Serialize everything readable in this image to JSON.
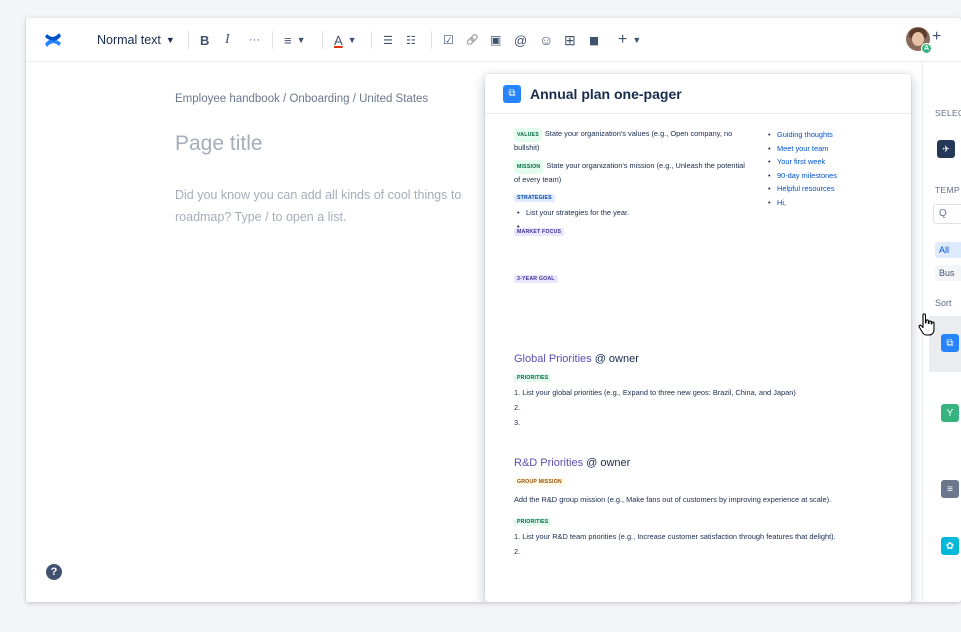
{
  "toolbar": {
    "text_style": "Normal text",
    "bold": "B",
    "italic": "I",
    "more": "···",
    "align": "≡",
    "text_color": "A",
    "bullet_list": "☰",
    "numbered_list": "☷",
    "action_item": "☑",
    "link": "🔗",
    "image": "▣",
    "mention": "@",
    "emoji": "☺",
    "table": "⊞",
    "layouts": "▮▮",
    "insert": "+",
    "avatar_badge": "A",
    "invite": "+"
  },
  "editor": {
    "breadcrumb": "Employee handbook  /  Onboarding / United States",
    "page_title": "Page title",
    "placeholder": "Did you know you can add all kinds of cool things to roadmap? Type / to open a list."
  },
  "help_icon": "?",
  "preview": {
    "title": "Annual plan one-pager",
    "values_label": "VALUES",
    "values_text": "State your organization's values (e.g., Open company, no bullshit)",
    "mission_label": "MISSION",
    "mission_text": "State your organization's mission (e.g., Unleash the potential of every team)",
    "strategies_label": "STRATEGIES",
    "strategies": [
      "List your strategies for the year.",
      "",
      ""
    ],
    "market_focus_label": "MARKET FOCUS",
    "goal_label": "3-YEAR GOAL",
    "right_links": [
      "Guiding thoughts",
      "Meet your team",
      "Your first week",
      "90-day milestones",
      "Helpful resources",
      "Hi,"
    ],
    "global_title": "Global Priorities",
    "global_owner": "@ owner",
    "priorities_label": "PRIORITIES",
    "global_items": [
      "1. List your global priorities (e.g., Expand to three new geos: Brazil, China, and Japan)",
      "2.",
      "3."
    ],
    "rd_title": "R&D Priorities",
    "rd_owner": "@ owner",
    "group_mission_label": "GROUP MISSION",
    "group_mission_text": "Add the R&D group mission (e.g., Make fans out of customers by improving experience at scale).",
    "rd_priorities_label": "PRIORITIES",
    "rd_items": [
      "1. List your R&D team priorities (e.g., Increase customer satisfaction through features that delight).",
      "2."
    ]
  },
  "right_panel": {
    "selected_label": "SELEC",
    "templates_label": "TEMP",
    "search_icon": "Q",
    "chip_all": "All",
    "chip_business": "Bus",
    "sort_label": "Sort"
  },
  "colors": {
    "brand": "#0052cc",
    "accent_blue": "#2684ff",
    "green": "#36b37e",
    "slate": "#6b778c",
    "teal": "#00b8d9",
    "purple": "#6554c0"
  }
}
